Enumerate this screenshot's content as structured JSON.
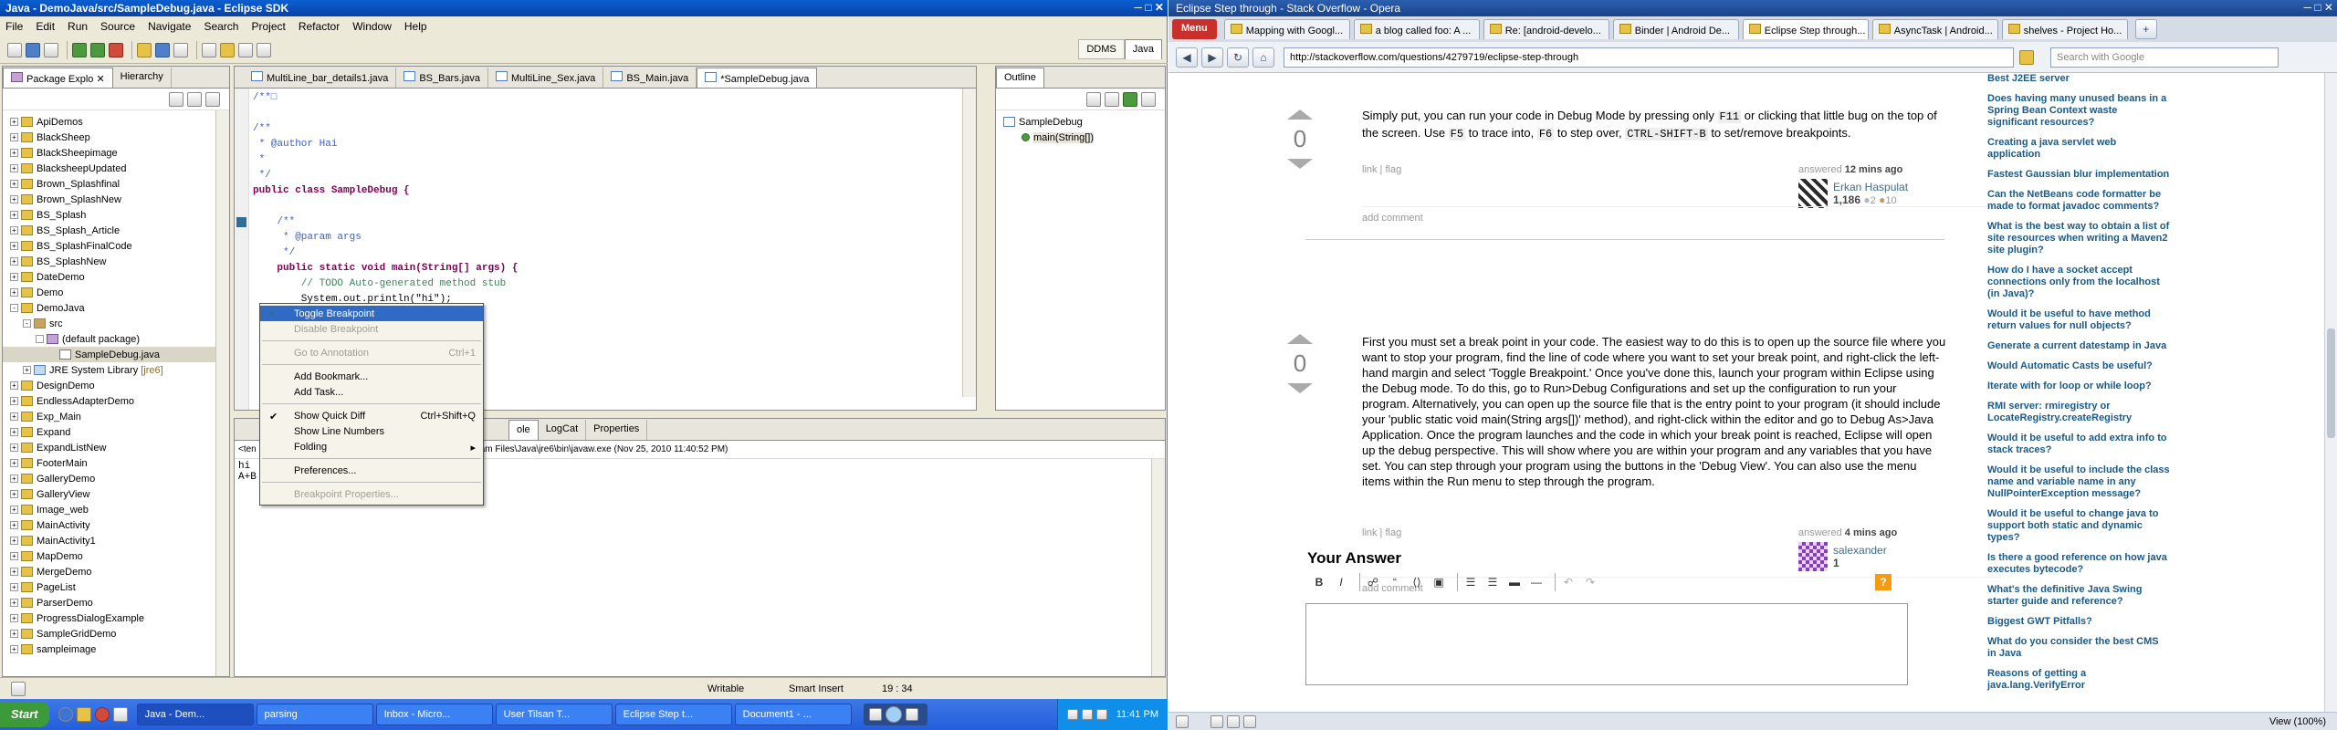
{
  "eclipse": {
    "title": "Java - DemoJava/src/SampleDebug.java - Eclipse SDK",
    "menu": [
      "File",
      "Edit",
      "Run",
      "Source",
      "Navigate",
      "Search",
      "Project",
      "Refactor",
      "Window",
      "Help"
    ],
    "perspectives": [
      "DDMS",
      "Java"
    ],
    "package_explorer": {
      "tabs": [
        "Package Explo",
        "Hierarchy"
      ],
      "items": [
        {
          "label": "ApiDemos",
          "indent": 0,
          "type": "project"
        },
        {
          "label": "BlackSheep",
          "indent": 0,
          "type": "project"
        },
        {
          "label": "BlackSheepimage",
          "indent": 0,
          "type": "project"
        },
        {
          "label": "BlacksheepUpdated",
          "indent": 0,
          "type": "project"
        },
        {
          "label": "Brown_Splashfinal",
          "indent": 0,
          "type": "project"
        },
        {
          "label": "Brown_SplashNew",
          "indent": 0,
          "type": "project"
        },
        {
          "label": "BS_Splash",
          "indent": 0,
          "type": "project"
        },
        {
          "label": "BS_Splash_Article",
          "indent": 0,
          "type": "project"
        },
        {
          "label": "BS_SplashFinalCode",
          "indent": 0,
          "type": "project"
        },
        {
          "label": "BS_SplashNew",
          "indent": 0,
          "type": "project"
        },
        {
          "label": "DateDemo",
          "indent": 0,
          "type": "project"
        },
        {
          "label": "Demo",
          "indent": 0,
          "type": "project"
        },
        {
          "label": "DemoJava",
          "indent": 0,
          "type": "project"
        },
        {
          "label": "src",
          "indent": 1,
          "type": "src"
        },
        {
          "label": "(default package)",
          "indent": 2,
          "type": "package"
        },
        {
          "label": "SampleDebug.java",
          "indent": 3,
          "type": "java"
        },
        {
          "label": "JRE System Library",
          "suffix": "[jre6]",
          "indent": 1,
          "type": "jre"
        },
        {
          "label": "DesignDemo",
          "indent": 0,
          "type": "project"
        },
        {
          "label": "EndlessAdapterDemo",
          "indent": 0,
          "type": "project"
        },
        {
          "label": "Exp_Main",
          "indent": 0,
          "type": "project"
        },
        {
          "label": "Expand",
          "indent": 0,
          "type": "project"
        },
        {
          "label": "ExpandListNew",
          "indent": 0,
          "type": "project"
        },
        {
          "label": "FooterMain",
          "indent": 0,
          "type": "project"
        },
        {
          "label": "GalleryDemo",
          "indent": 0,
          "type": "project"
        },
        {
          "label": "GalleryView",
          "indent": 0,
          "type": "project"
        },
        {
          "label": "Image_web",
          "indent": 0,
          "type": "project"
        },
        {
          "label": "MainActivity",
          "indent": 0,
          "type": "project"
        },
        {
          "label": "MainActivity1",
          "indent": 0,
          "type": "project"
        },
        {
          "label": "MapDemo",
          "indent": 0,
          "type": "project"
        },
        {
          "label": "MergeDemo",
          "indent": 0,
          "type": "project"
        },
        {
          "label": "PageList",
          "indent": 0,
          "type": "project"
        },
        {
          "label": "ParserDemo",
          "indent": 0,
          "type": "project"
        },
        {
          "label": "ProgressDialogExample",
          "indent": 0,
          "type": "project"
        },
        {
          "label": "SampleGridDemo",
          "indent": 0,
          "type": "project"
        },
        {
          "label": "sampleimage",
          "indent": 0,
          "type": "project"
        }
      ]
    },
    "editor_tabs": [
      "MultiLine_bar_details1.java",
      "BS_Bars.java",
      "MultiLine_Sex.java",
      "BS_Main.java",
      "*SampleDebug.java"
    ],
    "code": [
      "/**□",
      "",
      "/**",
      " * @author Hai",
      " *",
      " */",
      "public class SampleDebug {",
      "",
      "    /**",
      "     * @param args",
      "     */",
      "    public static void main(String[] args) {",
      "        // TODO Auto-generated method stub",
      "        System.out.println(\"hi\");",
      "",
      "        Sy... B t|+(a+b));",
      ""
    ],
    "outline": {
      "tab": "Outline",
      "class_name": "SampleDebug",
      "method": "main(String[])"
    },
    "context_menu": [
      {
        "label": "Toggle Breakpoint",
        "enabled": true,
        "shortcut": ""
      },
      {
        "label": "Disable Breakpoint",
        "enabled": false,
        "shortcut": ""
      },
      {
        "sep": true
      },
      {
        "label": "Go to Annotation",
        "enabled": false,
        "shortcut": "Ctrl+1"
      },
      {
        "sep": true
      },
      {
        "label": "Add Bookmark...",
        "enabled": true,
        "shortcut": ""
      },
      {
        "label": "Add Task...",
        "enabled": true,
        "shortcut": ""
      },
      {
        "sep": true
      },
      {
        "label": "Show Quick Diff",
        "enabled": true,
        "shortcut": "Ctrl+Shift+Q",
        "checked": true
      },
      {
        "label": "Show Line Numbers",
        "enabled": true,
        "shortcut": ""
      },
      {
        "label": "Folding",
        "enabled": true,
        "shortcut": "▸"
      },
      {
        "sep": true
      },
      {
        "label": "Preferences...",
        "enabled": true,
        "shortcut": ""
      },
      {
        "sep": true
      },
      {
        "label": "Breakpoint Properties...",
        "enabled": false,
        "shortcut": ""
      }
    ],
    "console": {
      "tabs": [
        "ole",
        "LogCat",
        "Properties"
      ],
      "header_left": "<ten",
      "header_right": "am Files\\Java\\jre6\\bin\\javaw.exe (Nov 25, 2010 11:40:52 PM)",
      "lines": [
        "hi",
        "A+B"
      ]
    },
    "status": {
      "writable": "Writable",
      "insert": "Smart Insert",
      "position": "19 : 34"
    },
    "taskbar": {
      "start": "Start",
      "buttons": [
        "Java - Dem...",
        "parsing",
        "Inbox - Micro...",
        "User Tilsan T...",
        "Eclipse Step t...",
        "Document1 - ..."
      ],
      "clock": "11:41 PM"
    }
  },
  "opera": {
    "title": "Eclipse Step through - Stack Overflow - Opera",
    "menu": "Menu",
    "tabs": [
      "Mapping with Googl...",
      "a blog called foo: A ...",
      "Re: [android-develo...",
      "Binder | Android De...",
      "Eclipse Step through...",
      "AsyncTask | Android...",
      "shelves - Project Ho..."
    ],
    "active_tab": 4,
    "url": "http://stackoverflow.com/questions/4279719/eclipse-step-through",
    "search_placeholder": "Search with Google",
    "answers": [
      {
        "votes": "0",
        "parts": [
          {
            "t": "Simply put, you can run your code in Debug Mode by pressing only "
          },
          {
            "c": "F11"
          },
          {
            "t": " or clicking that little bug on the top of the screen. Use "
          },
          {
            "c": "F5"
          },
          {
            "t": " to trace into, "
          },
          {
            "c": "F6"
          },
          {
            "t": " to step over, "
          },
          {
            "c": "CTRL-SHIFT-B"
          },
          {
            "t": " to set/remove breakpoints."
          }
        ],
        "links": "link | flag",
        "answered_prefix": "answered ",
        "answered_time": "12 mins ago",
        "user": "Erkan Haspulat",
        "rep": "1,186",
        "silver": "2",
        "bronze": "10",
        "add_comment": "add comment"
      },
      {
        "votes": "0",
        "parts": [
          {
            "t": "First you must set a break point in your code. The easiest way to do this is to open up the source file where you want to stop your program, find the line of code where you want to set your break point, and right-click the left-hand margin and select 'Toggle Breakpoint.' Once you've done this, launch your program within Eclipse using the Debug mode. To do this, go to Run>Debug Configurations and set up the configuration to run your program. Alternatively, you can open up the source file that is the entry point to your program (it should include your 'public static void main(String args[])' method), and right-click within the editor and go to Debug As>Java Application. Once the program launches and the code in which your break point is reached, Eclipse will open up the debug perspective. This will show where you are within your program and any variables that you have set. You can step through your program using the buttons in the 'Debug View'. You can also use the menu items within the Run menu to step through the program."
          }
        ],
        "links": "link | flag",
        "answered_prefix": "answered ",
        "answered_time": "4 mins ago",
        "user": "salexander",
        "rep": "1",
        "add_comment": "add comment"
      }
    ],
    "your_answer": "Your Answer",
    "sidebar": [
      "Best J2EE server",
      "Does having many unused beans in a Spring Bean Context waste significant resources?",
      "Creating a java servlet web application",
      "Fastest Gaussian blur implementation",
      "Can the NetBeans code formatter be made to format javadoc comments?",
      "What is the best way to obtain a list of site resources when writing a Maven2 site plugin?",
      "How do I have a socket accept connections only from the localhost (in Java)?",
      "Would it be useful to have method return values for null objects?",
      "Generate a current datestamp in Java",
      "Would Automatic Casts be useful?",
      "Iterate with for loop or while loop?",
      "RMI server: rmiregistry or LocateRegistry.createRegistry",
      "Would it be useful to add extra info to stack traces?",
      "Would it be useful to include the class name and variable name in any NullPointerException message?",
      "Would it be useful to change java to support both static and dynamic types?",
      "Is there a good reference on how java executes bytecode?",
      "What's the definitive Java Swing starter guide and reference?",
      "Biggest GWT Pitfalls?",
      "What do you consider the best CMS in Java",
      "Reasons of getting a java.lang.VerifyError"
    ],
    "editor_buttons": [
      "B",
      "I"
    ],
    "status_view": "View (100%)",
    "help_icon": "?"
  }
}
